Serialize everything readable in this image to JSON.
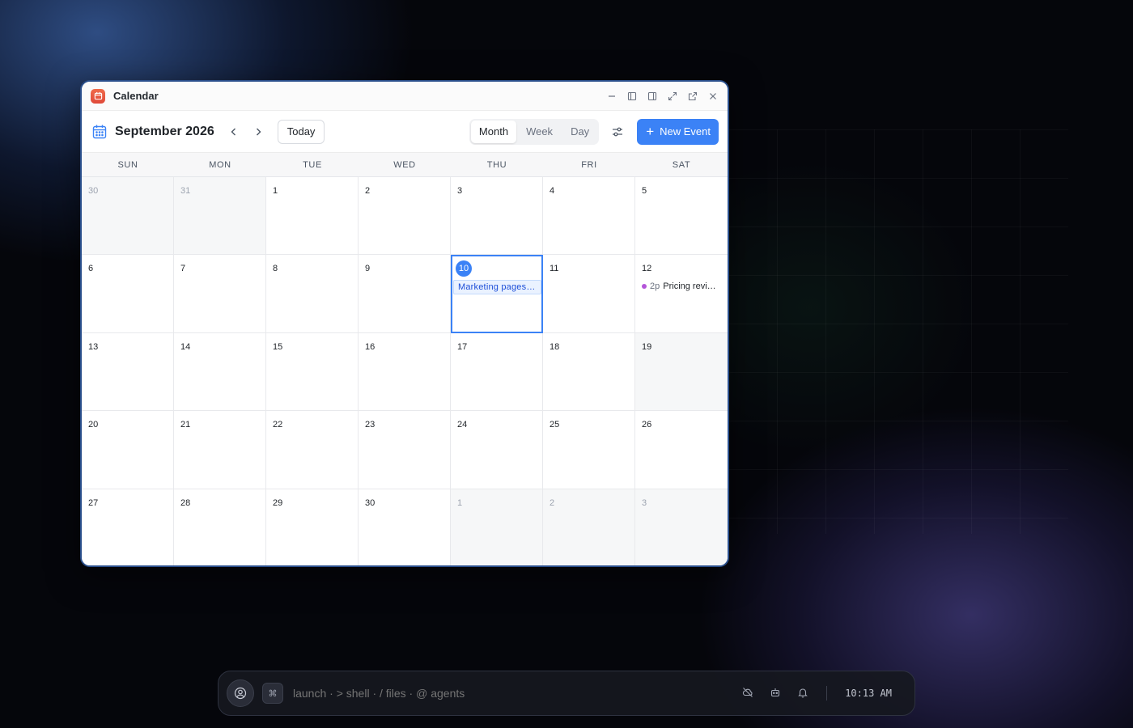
{
  "window": {
    "title": "Calendar"
  },
  "toolbar": {
    "month_title": "September 2026",
    "today_label": "Today",
    "views": [
      "Month",
      "Week",
      "Day"
    ],
    "active_view": "Month",
    "new_event_label": "New Event"
  },
  "weekdays": [
    "SUN",
    "MON",
    "TUE",
    "WED",
    "THU",
    "FRI",
    "SAT"
  ],
  "days": [
    {
      "n": "30",
      "muted": true
    },
    {
      "n": "31",
      "muted": true
    },
    {
      "n": "1"
    },
    {
      "n": "2"
    },
    {
      "n": "3"
    },
    {
      "n": "4"
    },
    {
      "n": "5"
    },
    {
      "n": "6"
    },
    {
      "n": "7"
    },
    {
      "n": "8"
    },
    {
      "n": "9"
    },
    {
      "n": "10",
      "today": true,
      "event_bar": "Marketing pages…"
    },
    {
      "n": "11"
    },
    {
      "n": "12",
      "event": {
        "time": "2p",
        "name": "Pricing revi…",
        "color": "#b455d9"
      }
    },
    {
      "n": "13"
    },
    {
      "n": "14"
    },
    {
      "n": "15"
    },
    {
      "n": "16"
    },
    {
      "n": "17"
    },
    {
      "n": "18"
    },
    {
      "n": "19",
      "shade": true
    },
    {
      "n": "20"
    },
    {
      "n": "21"
    },
    {
      "n": "22"
    },
    {
      "n": "23"
    },
    {
      "n": "24"
    },
    {
      "n": "25"
    },
    {
      "n": "26"
    },
    {
      "n": "27"
    },
    {
      "n": "28"
    },
    {
      "n": "29"
    },
    {
      "n": "30"
    },
    {
      "n": "1",
      "muted": true
    },
    {
      "n": "2",
      "muted": true
    },
    {
      "n": "3",
      "muted": true
    }
  ],
  "dock": {
    "command_placeholder": "launch · > shell · / files · @ agents",
    "cmd_key": "⌘",
    "time": "10:13 AM"
  },
  "colors": {
    "accent": "#3b82f6",
    "event_purple": "#b455d9"
  }
}
